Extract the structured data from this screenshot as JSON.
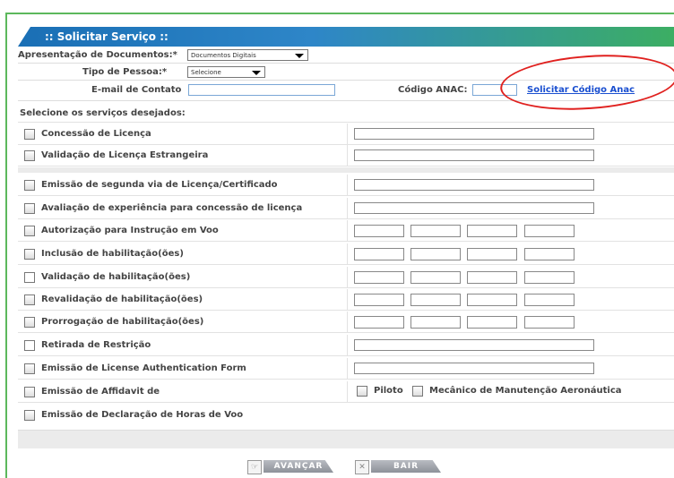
{
  "title": ":: Solicitar Serviço ::",
  "form": {
    "docs_label": "Apresentação de Documentos:*",
    "docs_value": "Documentos Digitais",
    "tipo_label": "Tipo de Pessoa:*",
    "tipo_value": "Selecione",
    "email_label": "E-mail de Contato",
    "email_value": "",
    "anac_label": "Código ANAC:",
    "anac_value": "",
    "anac_link": "Solicitar Código Anac"
  },
  "section_label": "Selecione os serviços desejados:",
  "services": [
    {
      "label": "Concessão de Licença"
    },
    {
      "label": "Validação de Licença Estrangeira"
    },
    {
      "label": "Emissão de segunda via de Licença/Certificado"
    },
    {
      "label": "Avaliação de experiência para concessão de licença"
    },
    {
      "label": "Autorização para Instrução em Voo"
    },
    {
      "label": "Inclusão de habilitação(ões)"
    },
    {
      "label": "Validação de habilitação(ões)"
    },
    {
      "label": "Revalidação de habilitação(ões)"
    },
    {
      "label": "Prorrogação de habilitação(ões)"
    },
    {
      "label": "Retirada de Restrição"
    },
    {
      "label": "Emissão de License Authentication Form"
    },
    {
      "label": "Emissão de Affidavit de"
    },
    {
      "label": "Emissão de Declaração de Horas de Voo"
    }
  ],
  "affidavit_options": {
    "piloto": "Piloto",
    "mecanico": "Mecânico de Manutenção Aeronáutica"
  },
  "buttons": {
    "avancar": "AVANÇAR",
    "bair": "BAIR"
  },
  "colors": {
    "title_start": "#1a6fb5",
    "title_end": "#3cae63",
    "frame": "#5cb85c",
    "annotation": "#e0201e",
    "link": "#1a4fd0"
  }
}
